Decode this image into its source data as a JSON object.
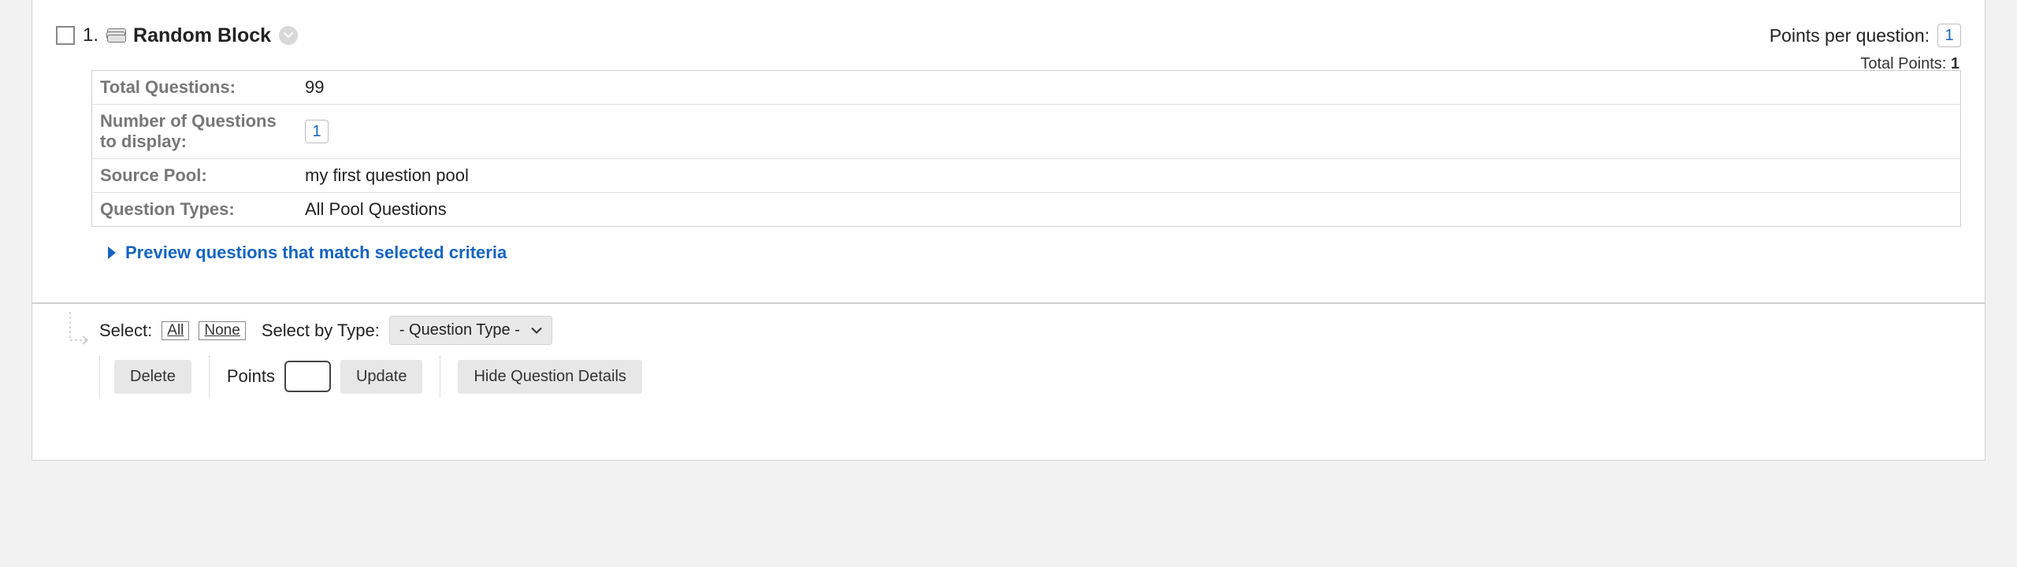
{
  "block": {
    "number": "1.",
    "title": "Random Block",
    "points_per_question_label": "Points per question:",
    "points_per_question_value": "1",
    "total_points_label": "Total Points:",
    "total_points_value": "1"
  },
  "details": {
    "total_questions_label": "Total Questions:",
    "total_questions_value": "99",
    "num_display_label": "Number of Questions to display:",
    "num_display_value": "1",
    "source_pool_label": "Source Pool:",
    "source_pool_value": "my first question pool",
    "question_types_label": "Question Types:",
    "question_types_value": "All Pool Questions"
  },
  "preview_link": "Preview questions that match selected criteria",
  "toolbar": {
    "select_label": "Select:",
    "all_label": "All",
    "none_label": "None",
    "select_by_type_label": "Select by Type:",
    "qtype_placeholder": "- Question Type -",
    "delete_label": "Delete",
    "points_label": "Points",
    "points_value": "",
    "update_label": "Update",
    "hide_label": "Hide Question Details"
  }
}
